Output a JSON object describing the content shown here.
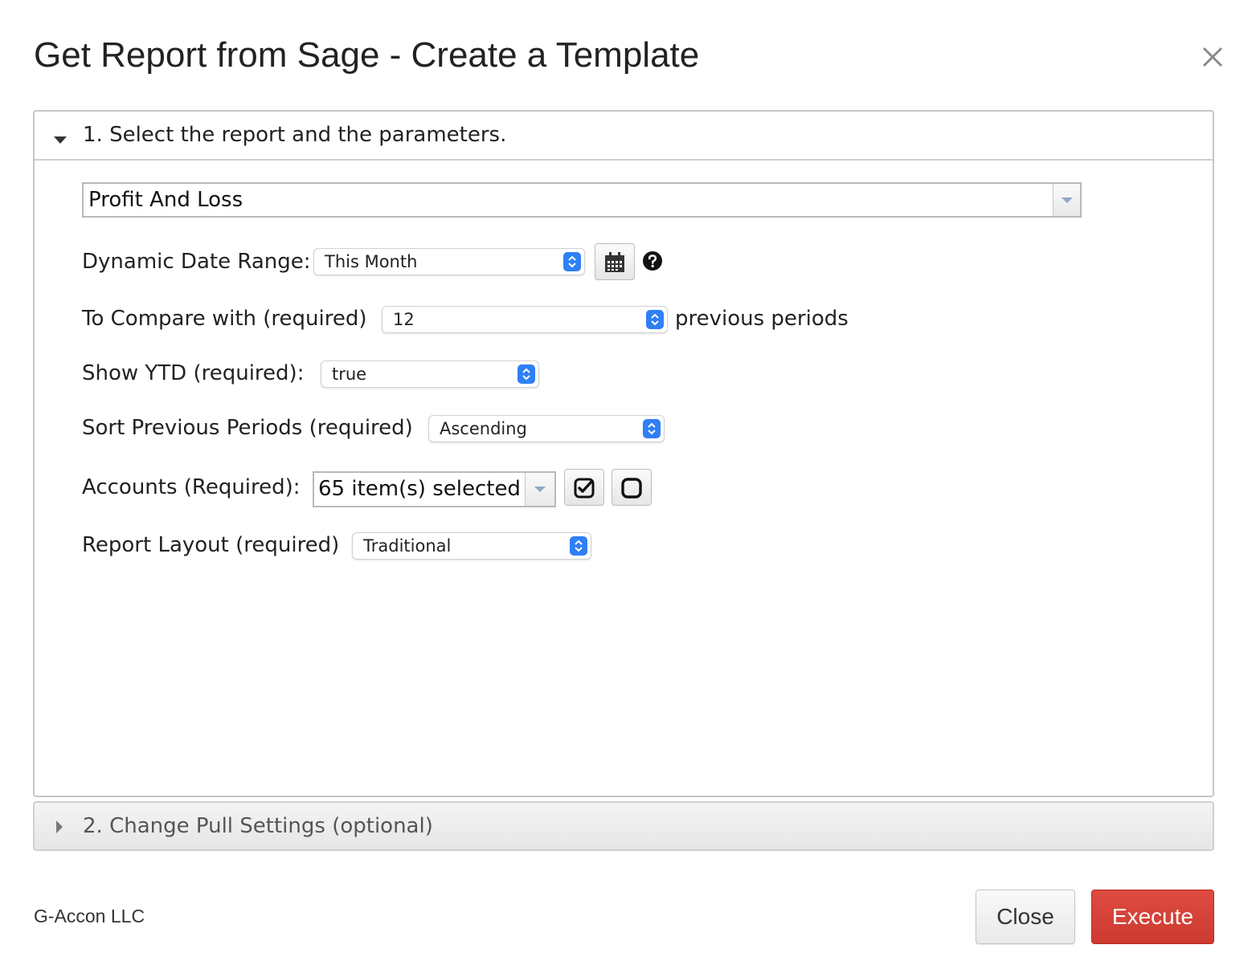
{
  "dialog": {
    "title": "Get Report from Sage - Create a Template",
    "close_icon": "close-icon"
  },
  "section1": {
    "header": "1. Select the report and the parameters.",
    "expanded": true,
    "report": {
      "value": "Profit And Loss"
    },
    "fields": {
      "date_range": {
        "label": "Dynamic Date Range:",
        "value": "This Month"
      },
      "compare": {
        "label": "To Compare with (required)",
        "value": "12",
        "suffix": "previous periods"
      },
      "ytd": {
        "label": "Show YTD (required):",
        "value": "true"
      },
      "sort": {
        "label": "Sort Previous Periods (required)",
        "value": "Ascending"
      },
      "accounts": {
        "label": "Accounts (Required):",
        "value": "65 item(s) selected"
      },
      "layout": {
        "label": "Report Layout (required)",
        "value": "Traditional"
      }
    },
    "icons": {
      "calendar": "calendar-icon",
      "help": "help-icon",
      "select_all": "checkbox-checked-icon",
      "deselect_all": "checkbox-empty-icon"
    }
  },
  "section2": {
    "header": "2. Change Pull Settings (optional)",
    "expanded": false
  },
  "footer": {
    "brand": "G-Accon LLC",
    "close_label": "Close",
    "execute_label": "Execute"
  },
  "colors": {
    "execute": "#d1453b",
    "select_spinner": "#2f7ff5"
  }
}
